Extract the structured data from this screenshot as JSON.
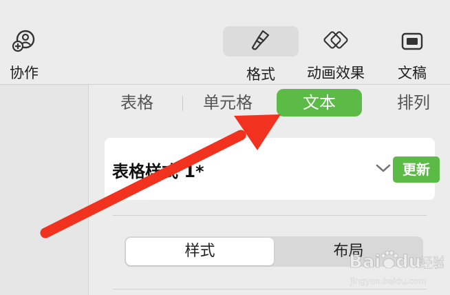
{
  "toolbar": {
    "collaborate_label": "协作",
    "format_label": "格式",
    "animation_label": "动画效果",
    "document_label": "文稿"
  },
  "inspector": {
    "tabs": [
      {
        "label": "表格",
        "selected": false
      },
      {
        "label": "单元格",
        "selected": false
      },
      {
        "label": "文本",
        "selected": true
      },
      {
        "label": "排列",
        "selected": false
      }
    ],
    "style_name": "表格样式 1*",
    "update_label": "更新",
    "segments": [
      {
        "label": "样式",
        "selected": true
      },
      {
        "label": "布局",
        "selected": false
      }
    ]
  },
  "colors": {
    "accent_green": "#5cba47",
    "annotation_red": "#f0321e"
  },
  "watermark": {
    "brand": "Bai du 经验",
    "url": "jingyan.baidu.com"
  }
}
